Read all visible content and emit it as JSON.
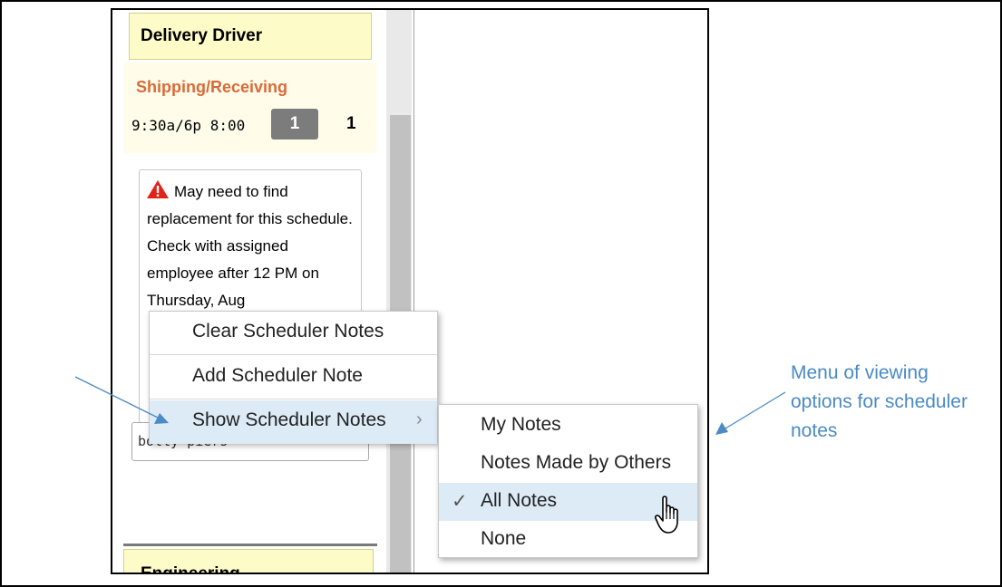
{
  "shift": {
    "title": "Delivery Driver",
    "department": "Shipping/Receiving",
    "time": "9:30a/6p 8:00",
    "badge_count": "1",
    "count": "1"
  },
  "note": {
    "text": "May need to find replacement for this schedule. Check with assigned employee after 12 PM on Thursday, Aug"
  },
  "employee_field": {
    "value": "bolly piers"
  },
  "next_shift": {
    "title": "Engineering"
  },
  "context_menu": {
    "items": [
      {
        "label": "Clear Scheduler Notes"
      },
      {
        "label": "Add Scheduler Note"
      },
      {
        "label": "Show Scheduler Notes"
      }
    ],
    "chevron": "›"
  },
  "submenu": {
    "items": [
      {
        "label": "My Notes"
      },
      {
        "label": "Notes Made by Others"
      },
      {
        "label": "All Notes",
        "checked": true
      },
      {
        "label": "None"
      }
    ],
    "check_glyph": "✓"
  },
  "annotation": {
    "text": "Menu of viewing options for scheduler notes"
  },
  "colors": {
    "accent": "#4a8ac5",
    "highlight": "#dcebf6",
    "shift_header": "#fdfbc8",
    "department": "#d96a3a"
  },
  "icons": [
    "warning-icon",
    "chevron-right-icon",
    "checkmark-icon",
    "hand-cursor-icon",
    "arrow-icon"
  ]
}
